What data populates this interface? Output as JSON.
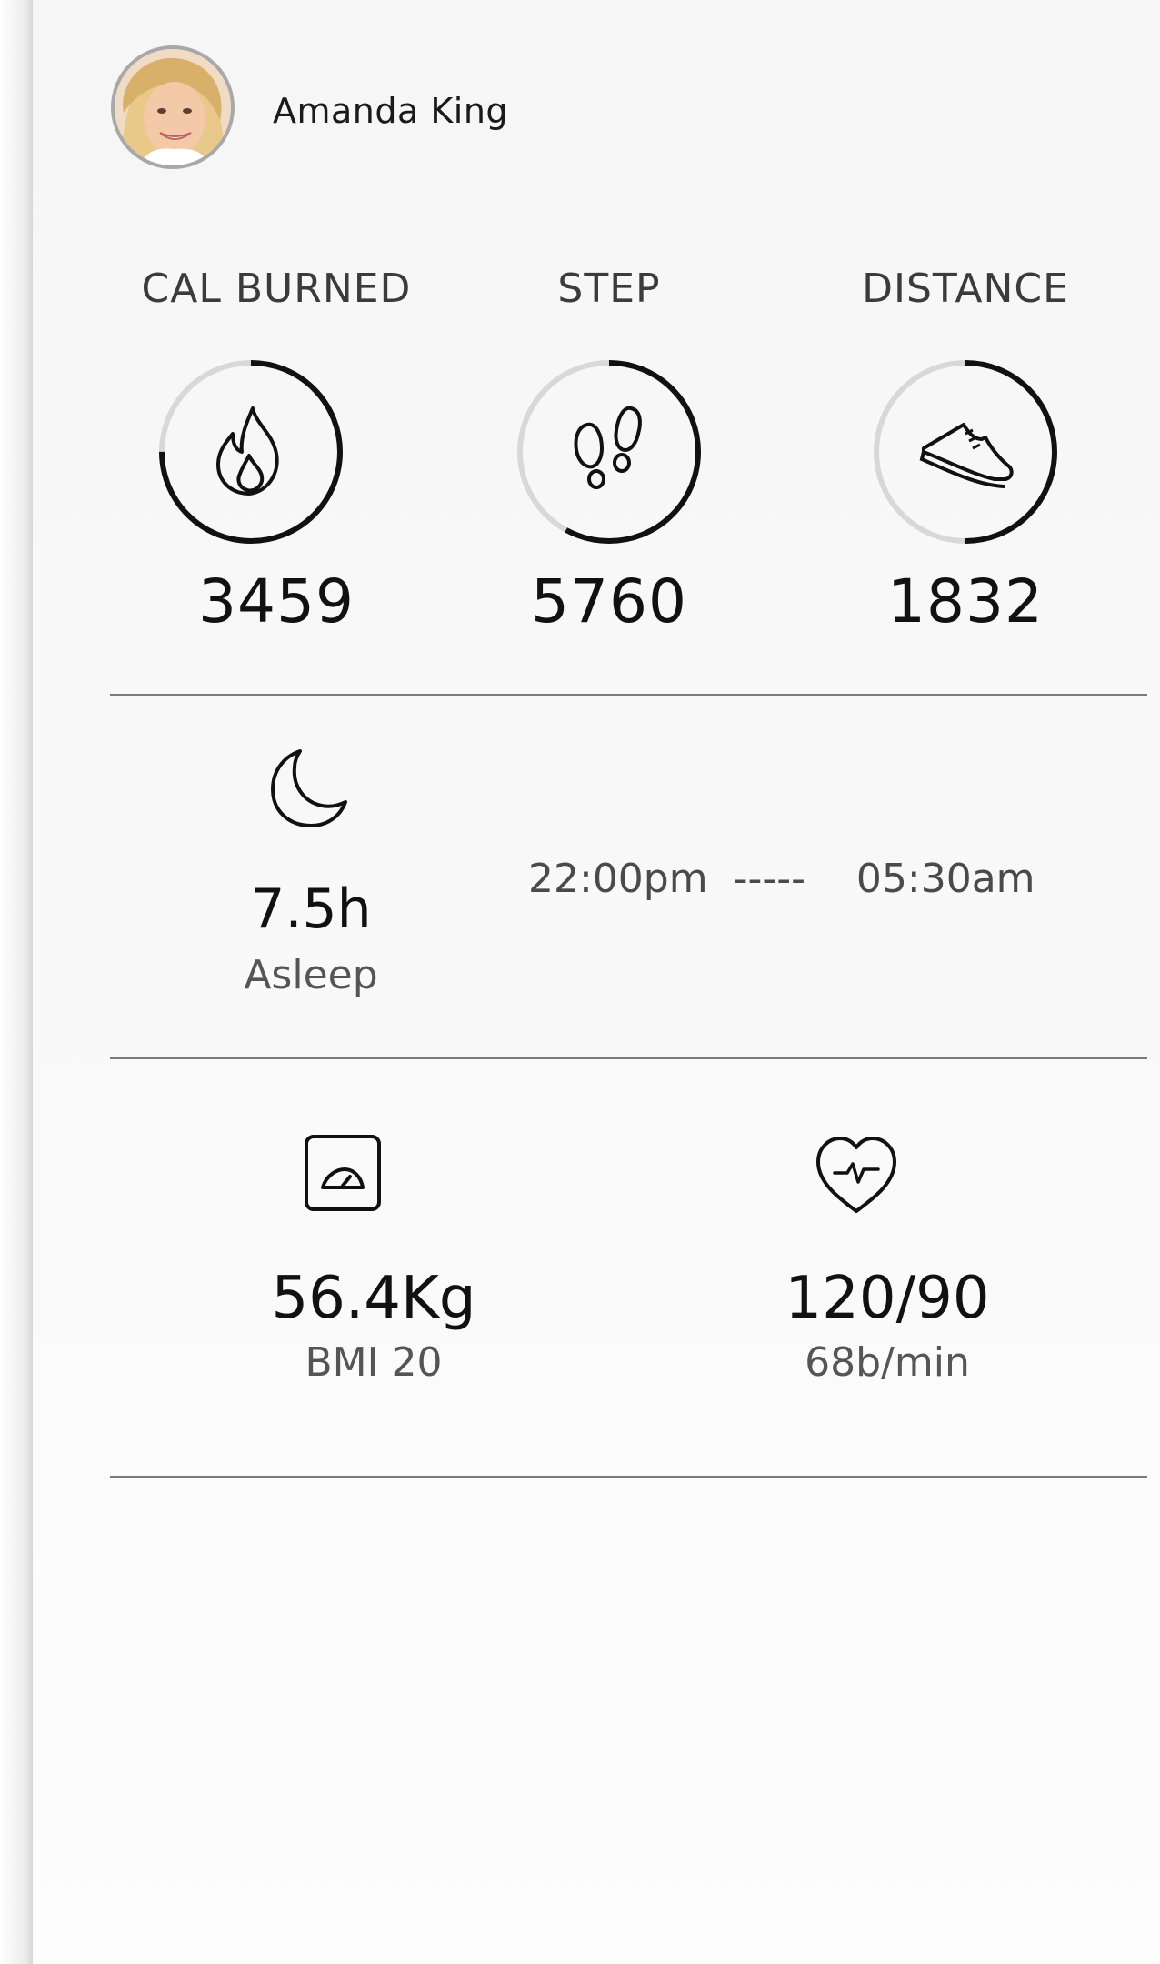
{
  "profile": {
    "name": "Amanda King",
    "avatar_icon": "user-avatar-photo"
  },
  "stats": [
    {
      "label": "CAL BURNED",
      "value": "3459",
      "icon": "flame-icon",
      "progress": 0.75
    },
    {
      "label": "STEP",
      "value": "5760",
      "icon": "footprints-icon",
      "progress": 0.58
    },
    {
      "label": "DISTANCE",
      "value": "1832",
      "icon": "sneaker-icon",
      "progress": 0.5
    }
  ],
  "sleep": {
    "icon": "moon-icon",
    "hours": "7.5h",
    "label": "Asleep",
    "start": "22:00pm",
    "separator": "-----",
    "end": "05:30am"
  },
  "weight": {
    "icon": "scale-icon",
    "value": "56.4Kg",
    "sub": "BMI 20"
  },
  "heart": {
    "icon": "heart-pulse-icon",
    "value": "120/90",
    "sub": "68b/min"
  },
  "colors": {
    "ring_active": "#111111",
    "ring_track": "#d8d8d8",
    "divider": "#7a7a7a"
  }
}
